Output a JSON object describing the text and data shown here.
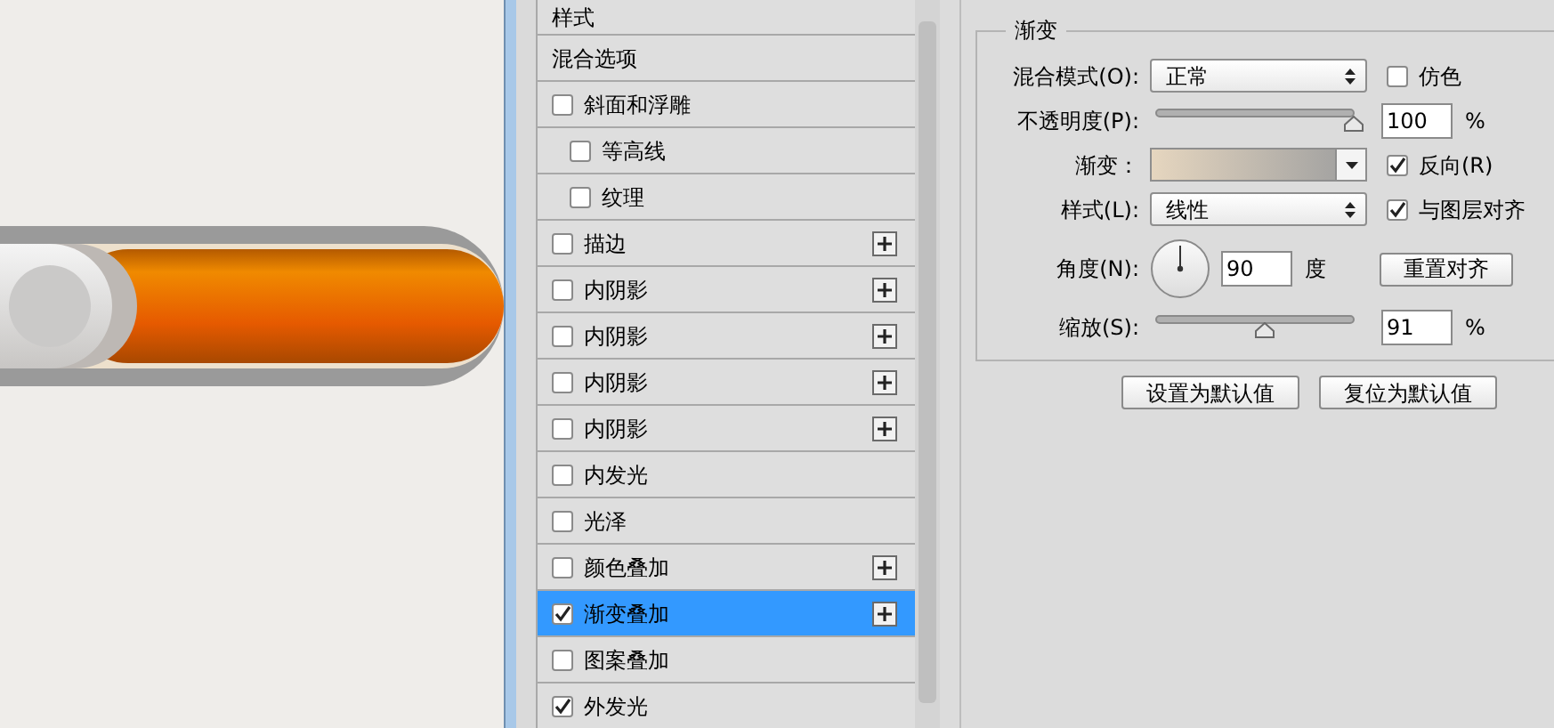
{
  "style_list": {
    "header": "样式",
    "items": [
      {
        "label": "混合选项",
        "kind": "plain",
        "selected": false
      },
      {
        "label": "斜面和浮雕",
        "kind": "check",
        "checked": false,
        "add": false,
        "selected": false,
        "children": [
          {
            "label": "等高线",
            "kind": "check",
            "checked": false,
            "add": false,
            "selected": false
          },
          {
            "label": "纹理",
            "kind": "check",
            "checked": false,
            "add": false,
            "selected": false
          }
        ]
      },
      {
        "label": "描边",
        "kind": "check",
        "checked": false,
        "add": true,
        "selected": false
      },
      {
        "label": "内阴影",
        "kind": "check",
        "checked": false,
        "add": true,
        "selected": false
      },
      {
        "label": "内阴影",
        "kind": "check",
        "checked": false,
        "add": true,
        "selected": false
      },
      {
        "label": "内阴影",
        "kind": "check",
        "checked": false,
        "add": true,
        "selected": false
      },
      {
        "label": "内阴影",
        "kind": "check",
        "checked": false,
        "add": true,
        "selected": false
      },
      {
        "label": "内发光",
        "kind": "check",
        "checked": false,
        "add": false,
        "selected": false
      },
      {
        "label": "光泽",
        "kind": "check",
        "checked": false,
        "add": false,
        "selected": false
      },
      {
        "label": "颜色叠加",
        "kind": "check",
        "checked": false,
        "add": true,
        "selected": false
      },
      {
        "label": "渐变叠加",
        "kind": "check",
        "checked": true,
        "add": true,
        "selected": true
      },
      {
        "label": "图案叠加",
        "kind": "check",
        "checked": false,
        "add": false,
        "selected": false
      },
      {
        "label": "外发光",
        "kind": "check",
        "checked": true,
        "add": false,
        "selected": false
      }
    ]
  },
  "gradient_group": {
    "title": "渐变",
    "blend_mode": {
      "label": "混合模式(O):",
      "value": "正常"
    },
    "dither": {
      "label": "仿色",
      "checked": false
    },
    "opacity": {
      "label": "不透明度(P):",
      "level": 1,
      "value": "100",
      "unit": "%"
    },
    "gradient": {
      "label": "渐变："
    },
    "reverse": {
      "label": "反向(R)",
      "checked": true
    },
    "style": {
      "label": "样式(L):",
      "value": "线性"
    },
    "align_with_layer": {
      "label": "与图层对齐",
      "checked": true
    },
    "angle": {
      "label": "角度(N):",
      "value": "90",
      "unit": "度"
    },
    "reset_alignment": "重置对齐",
    "scale": {
      "label": "缩放(S):",
      "level": 0.55,
      "value": "91",
      "unit": "%"
    }
  },
  "buttons": [
    "设置为默认值",
    "复位为默认值"
  ]
}
